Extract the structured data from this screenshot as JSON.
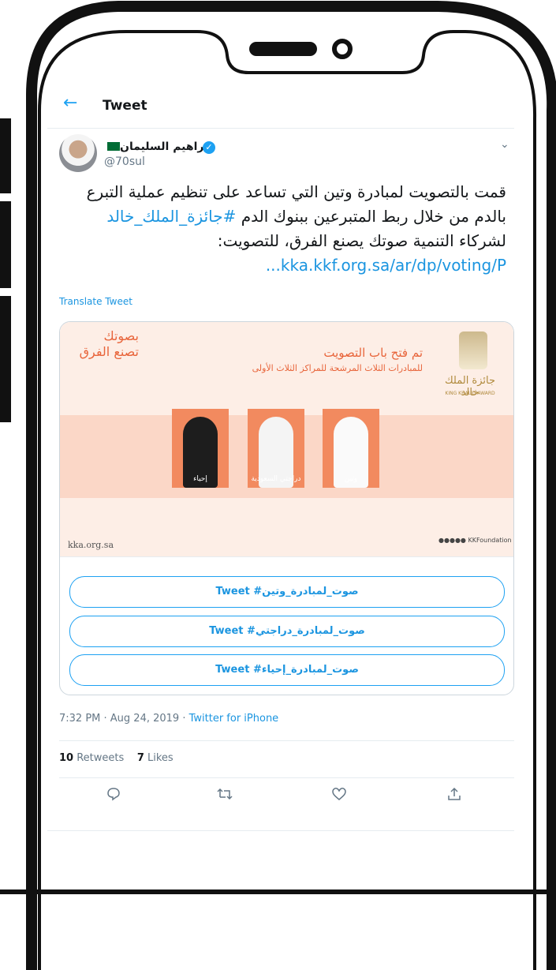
{
  "header": {
    "back_icon": "arrow-left-icon",
    "title": "Tweet"
  },
  "tweet": {
    "author_name": "إبراهيم السليمان",
    "author_handle": "@70sul",
    "text_part1": "قمت بالتصويت لمبادرة وتين التي تساعد على تنظيم عملية التبرع بالدم من خلال ربط المتبرعين ببنوك الدم",
    "hashtag": "#جائزة_الملك_خالد",
    "text_part2": " لشركاء التنمية صوتك يصنع الفرق، للتصويت: ",
    "url": "kka.kkf.org.sa/ar/dp/voting/P...",
    "translate_label": "Translate Tweet",
    "timestamp": "7:32 PM · Aug 24, 2019",
    "separator": " · ",
    "source": "Twitter for iPhone",
    "retweets_count": "10",
    "retweets_label": "Retweets",
    "likes_count": "7",
    "likes_label": "Likes"
  },
  "card": {
    "slogan_line1": "بصوتك",
    "slogan_line2": "تصنع الفرق",
    "heading": "تم فتح باب التصويت",
    "subheading": "للمبادرات الثلاث المرشحة للمراكز الثلاث الأولى",
    "award_name_ar": "جائزة الملك خالد",
    "award_name_en": "KING KHALID AWARD",
    "initiative_1": "إحياء",
    "initiative_2": "دراجتي السعودية",
    "initiative_3": "وتين",
    "site": "kka.org.sa",
    "social_handle": "KKFoundation",
    "poll_options": [
      "صوت_لمبادرة_وتين# Tweet",
      "صوت_لمبادرة_دراجتي# Tweet",
      "صوت_لمبادرة_إحياء# Tweet"
    ]
  },
  "actions": [
    "reply-icon",
    "retweet-icon",
    "like-icon",
    "share-icon"
  ],
  "colors": {
    "accent": "#1da1f2",
    "card_orange": "#e8643a"
  }
}
